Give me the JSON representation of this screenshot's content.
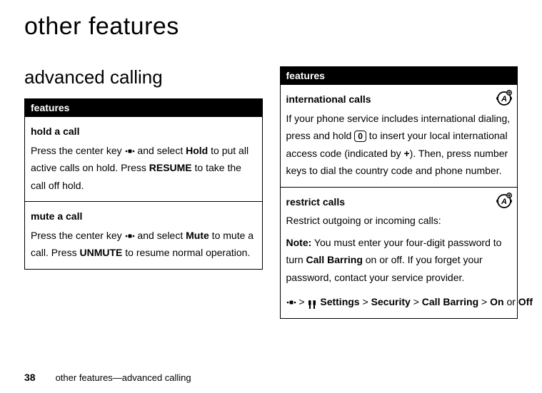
{
  "page_title": "other features",
  "section_title": "advanced calling",
  "left_table": {
    "header": "features",
    "rows": [
      {
        "name": "hold a call",
        "text_parts": {
          "p1": "Press the center key ",
          "p2": " and select ",
          "hold": "Hold",
          "p3": " to put all active calls on hold. Press ",
          "resume": "RESUME",
          "p4": " to take the call off hold."
        }
      },
      {
        "name": "mute a call",
        "text_parts": {
          "p1": "Press the center key ",
          "p2": " and select ",
          "mute": "Mute",
          "p3": " to mute a call. Press ",
          "unmute": "UNMUTE",
          "p4": " to resume normal operation."
        }
      }
    ]
  },
  "right_table": {
    "header": "features",
    "rows": [
      {
        "name": "international calls",
        "text_parts": {
          "p1": "If your phone service includes international dialing, press and hold ",
          "key": "0",
          "p2": " to insert your local international access code (indicated by ",
          "plus": "+",
          "p3": "). Then, press number keys to dial the country code and phone number."
        }
      },
      {
        "name": "restrict calls",
        "text_parts": {
          "intro": "Restrict outgoing or incoming calls:",
          "note_label": "Note:",
          "note_body": " You must enter your four-digit password to turn ",
          "callbarring1": "Call Barring",
          "note_body2": " on or off. If you forget your password, contact your service provider.",
          "path_gt": " > ",
          "settings": "Settings",
          "security": "Security",
          "callbarring2": "Call Barring",
          "on": "On",
          "or": " or ",
          "off": "Off"
        }
      }
    ]
  },
  "footer": {
    "page": "38",
    "text": "other features—advanced calling"
  }
}
